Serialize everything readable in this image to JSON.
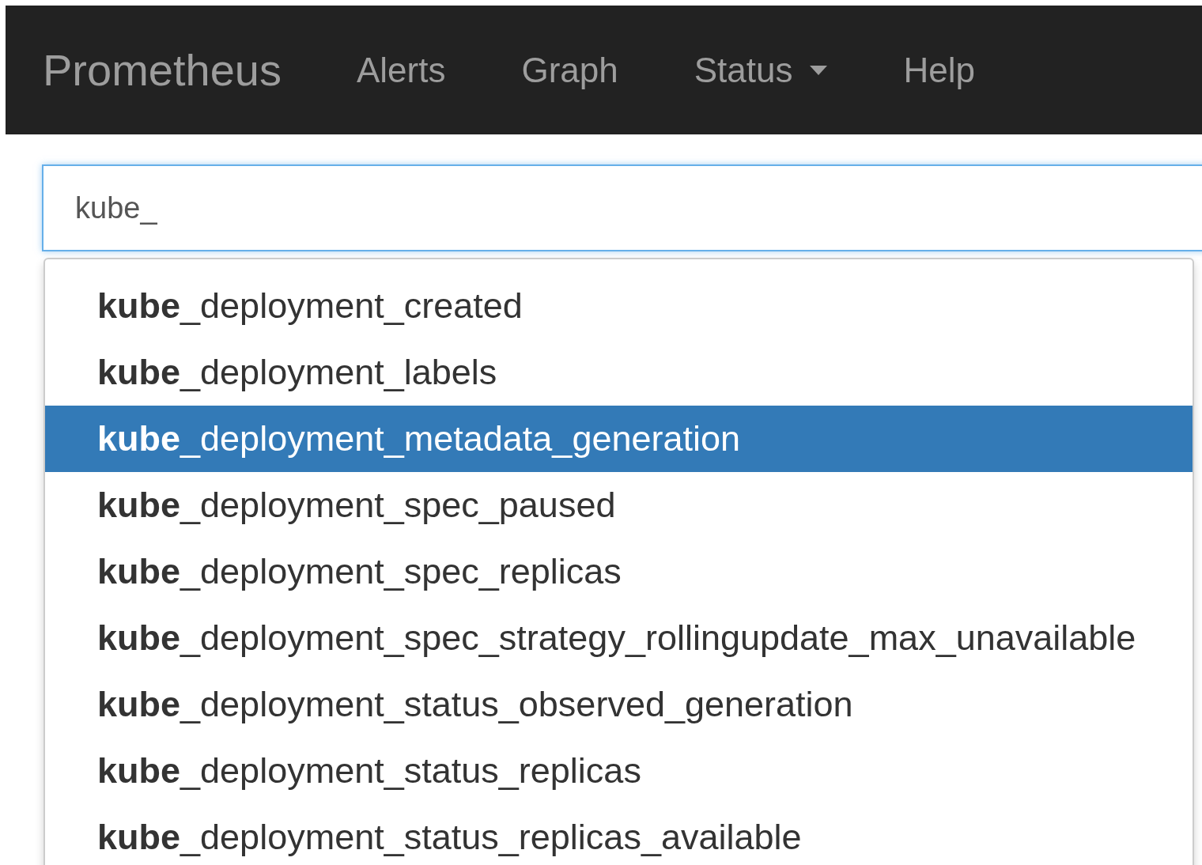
{
  "navbar": {
    "brand": "Prometheus",
    "items": [
      {
        "label": "Alerts",
        "dropdown": false
      },
      {
        "label": "Graph",
        "dropdown": false
      },
      {
        "label": "Status",
        "dropdown": true
      },
      {
        "label": "Help",
        "dropdown": false
      }
    ]
  },
  "query": {
    "value": "kube_"
  },
  "suggestions": [
    {
      "text": "**kube**_deployment_created",
      "selected": false
    },
    {
      "text": "**kube**_deployment_labels",
      "selected": false
    },
    {
      "text": "**kube**_deployment_metadata_generation",
      "selected": true
    },
    {
      "text": "**kube**_deployment_spec_paused",
      "selected": false
    },
    {
      "text": "**kube**_deployment_spec_replicas",
      "selected": false
    },
    {
      "text": "**kube**_deployment_spec_strategy_rollingupdate_max_unavailable",
      "selected": false
    },
    {
      "text": "**kube**_deployment_status_observed_generation",
      "selected": false
    },
    {
      "text": "**kube**_deployment_status_replicas",
      "selected": false
    },
    {
      "text": "**kube**_deployment_status_replicas_available",
      "selected": false
    }
  ]
}
